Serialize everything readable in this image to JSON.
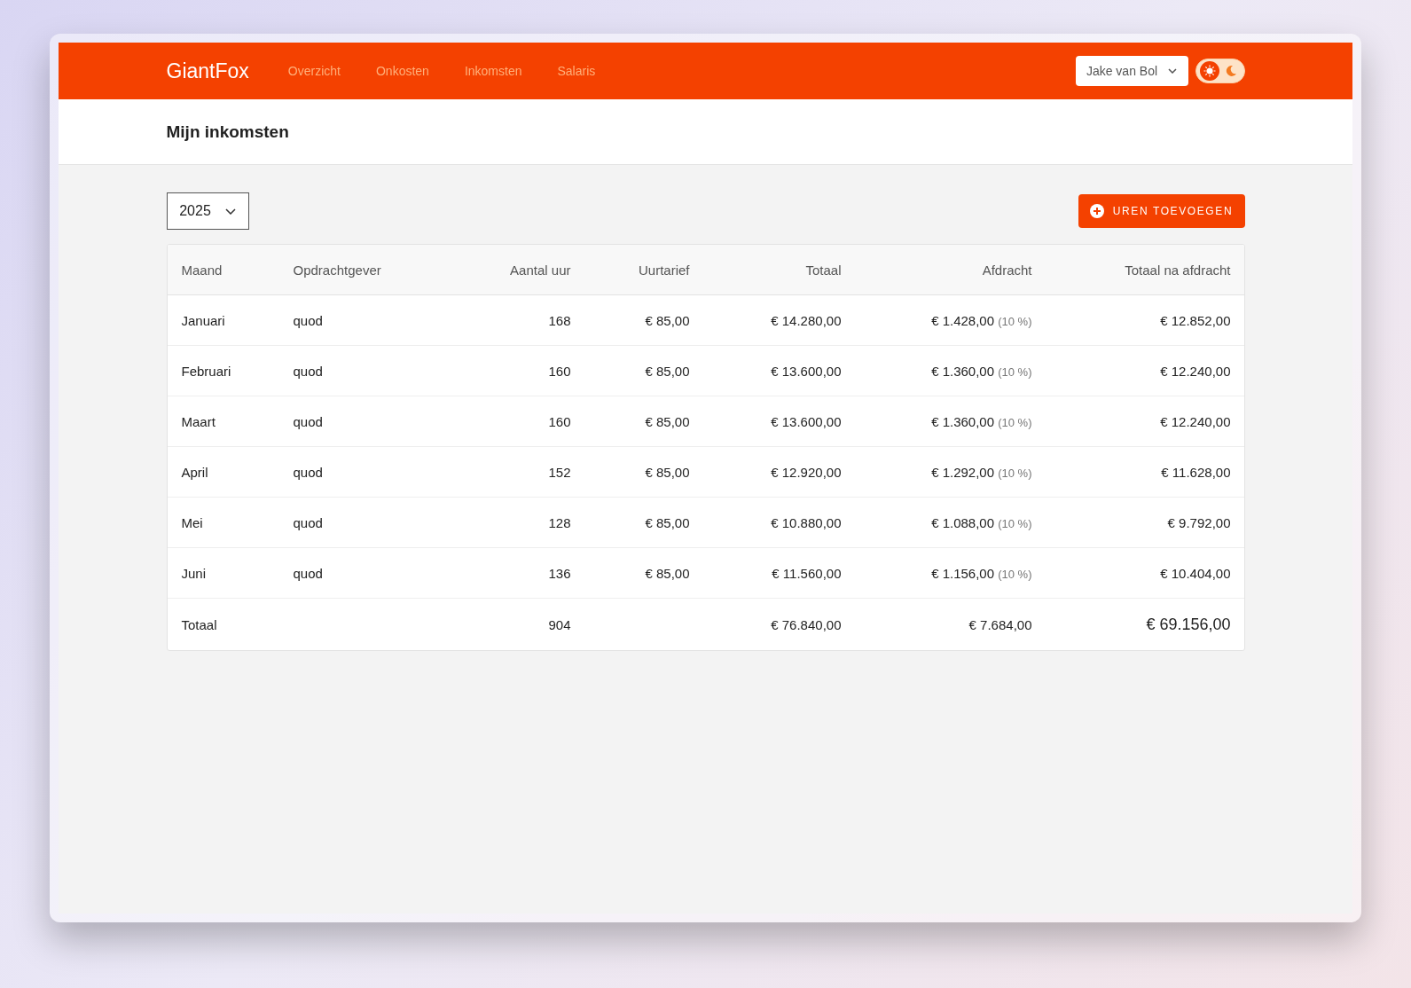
{
  "nav": {
    "brand": "GiantFox",
    "links": [
      {
        "label": "Overzicht"
      },
      {
        "label": "Onkosten"
      },
      {
        "label": "Inkomsten"
      },
      {
        "label": "Salaris"
      }
    ],
    "user_menu": {
      "label": "Jake van Bol"
    },
    "theme_toggle": {
      "dark": false
    }
  },
  "page_title": "Mijn inkomsten",
  "year_select": {
    "value": "2025"
  },
  "add_button": {
    "label": "UREN TOEVOEGEN"
  },
  "table": {
    "columns": [
      {
        "label": "Maand"
      },
      {
        "label": "Opdrachtgever"
      },
      {
        "label": "Aantal uur"
      },
      {
        "label": "Uurtarief"
      },
      {
        "label": "Totaal"
      },
      {
        "label": "Afdracht"
      },
      {
        "label": "Totaal na afdracht"
      }
    ],
    "rows": [
      {
        "maand": "Januari",
        "opdrachtgever": "quod",
        "uren": "168",
        "uurtarief": "€ 85,00",
        "totaal": "€ 14.280,00",
        "afdracht": "€ 1.428,00",
        "afdracht_percentage": "(10 %)",
        "netto": "€ 12.852,00"
      },
      {
        "maand": "Februari",
        "opdrachtgever": "quod",
        "uren": "160",
        "uurtarief": "€ 85,00",
        "totaal": "€ 13.600,00",
        "afdracht": "€ 1.360,00",
        "afdracht_percentage": "(10 %)",
        "netto": "€ 12.240,00"
      },
      {
        "maand": "Maart",
        "opdrachtgever": "quod",
        "uren": "160",
        "uurtarief": "€ 85,00",
        "totaal": "€ 13.600,00",
        "afdracht": "€ 1.360,00",
        "afdracht_percentage": "(10 %)",
        "netto": "€ 12.240,00"
      },
      {
        "maand": "April",
        "opdrachtgever": "quod",
        "uren": "152",
        "uurtarief": "€ 85,00",
        "totaal": "€ 12.920,00",
        "afdracht": "€ 1.292,00",
        "afdracht_percentage": "(10 %)",
        "netto": "€ 11.628,00"
      },
      {
        "maand": "Mei",
        "opdrachtgever": "quod",
        "uren": "128",
        "uurtarief": "€ 85,00",
        "totaal": "€ 10.880,00",
        "afdracht": "€ 1.088,00",
        "afdracht_percentage": "(10 %)",
        "netto": "€ 9.792,00"
      },
      {
        "maand": "Juni",
        "opdrachtgever": "quod",
        "uren": "136",
        "uurtarief": "€ 85,00",
        "totaal": "€ 11.560,00",
        "afdracht": "€ 1.156,00",
        "afdracht_percentage": "(10 %)",
        "netto": "€ 10.404,00"
      }
    ],
    "total_row": {
      "label": "Totaal",
      "uren": "904",
      "totaal": "€ 76.840,00",
      "afdracht": "€ 7.684,00",
      "netto": "€ 69.156,00"
    }
  }
}
